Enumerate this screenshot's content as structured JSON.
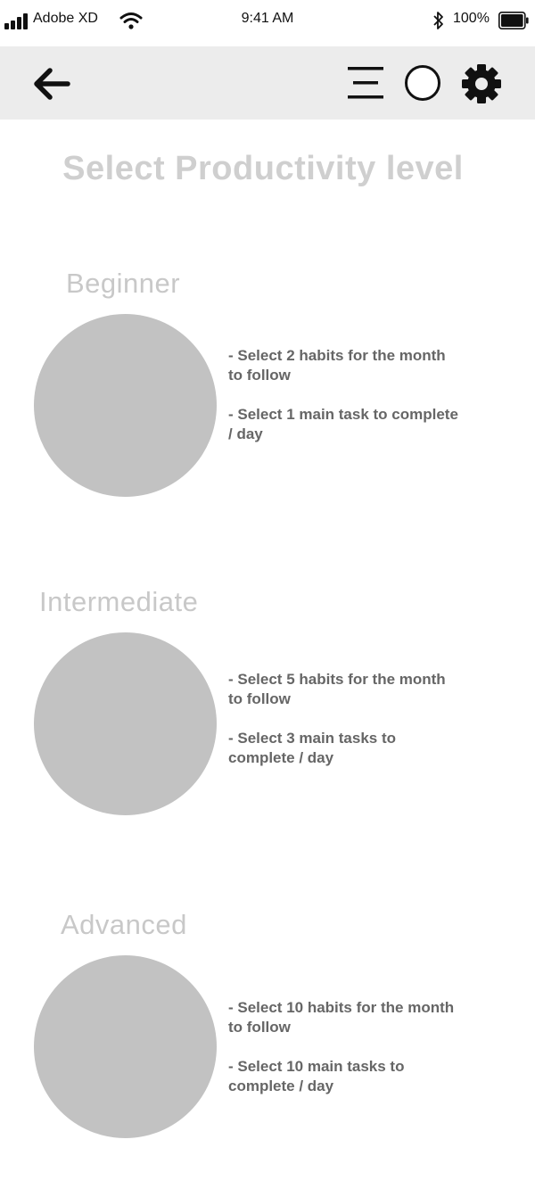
{
  "status_bar": {
    "carrier": "Adobe XD",
    "time": "9:41 AM",
    "battery": "100%"
  },
  "toolbar": {
    "icons": [
      "back-arrow-icon",
      "menu-icon",
      "circle-icon",
      "gear-icon"
    ]
  },
  "page": {
    "title": "Select Productivity level"
  },
  "levels": [
    {
      "name": "Beginner",
      "line1": "- Select 2 habits for the month to follow",
      "line2": "- Select 1 main task to complete / day"
    },
    {
      "name": "Intermediate",
      "line1": "- Select 5 habits for the month to follow",
      "line2": "- Select 3 main tasks to complete / day"
    },
    {
      "name": "Advanced",
      "line1": "- Select 10 habits for the month to follow",
      "line2": "- Select 10 main tasks to complete / day"
    }
  ],
  "colors": {
    "toolbar_bg": "#ececec",
    "circle": "#c2c2c2",
    "title": "#cfcfcf",
    "level_title": "#c8c8c8",
    "desc_text": "#666666"
  }
}
